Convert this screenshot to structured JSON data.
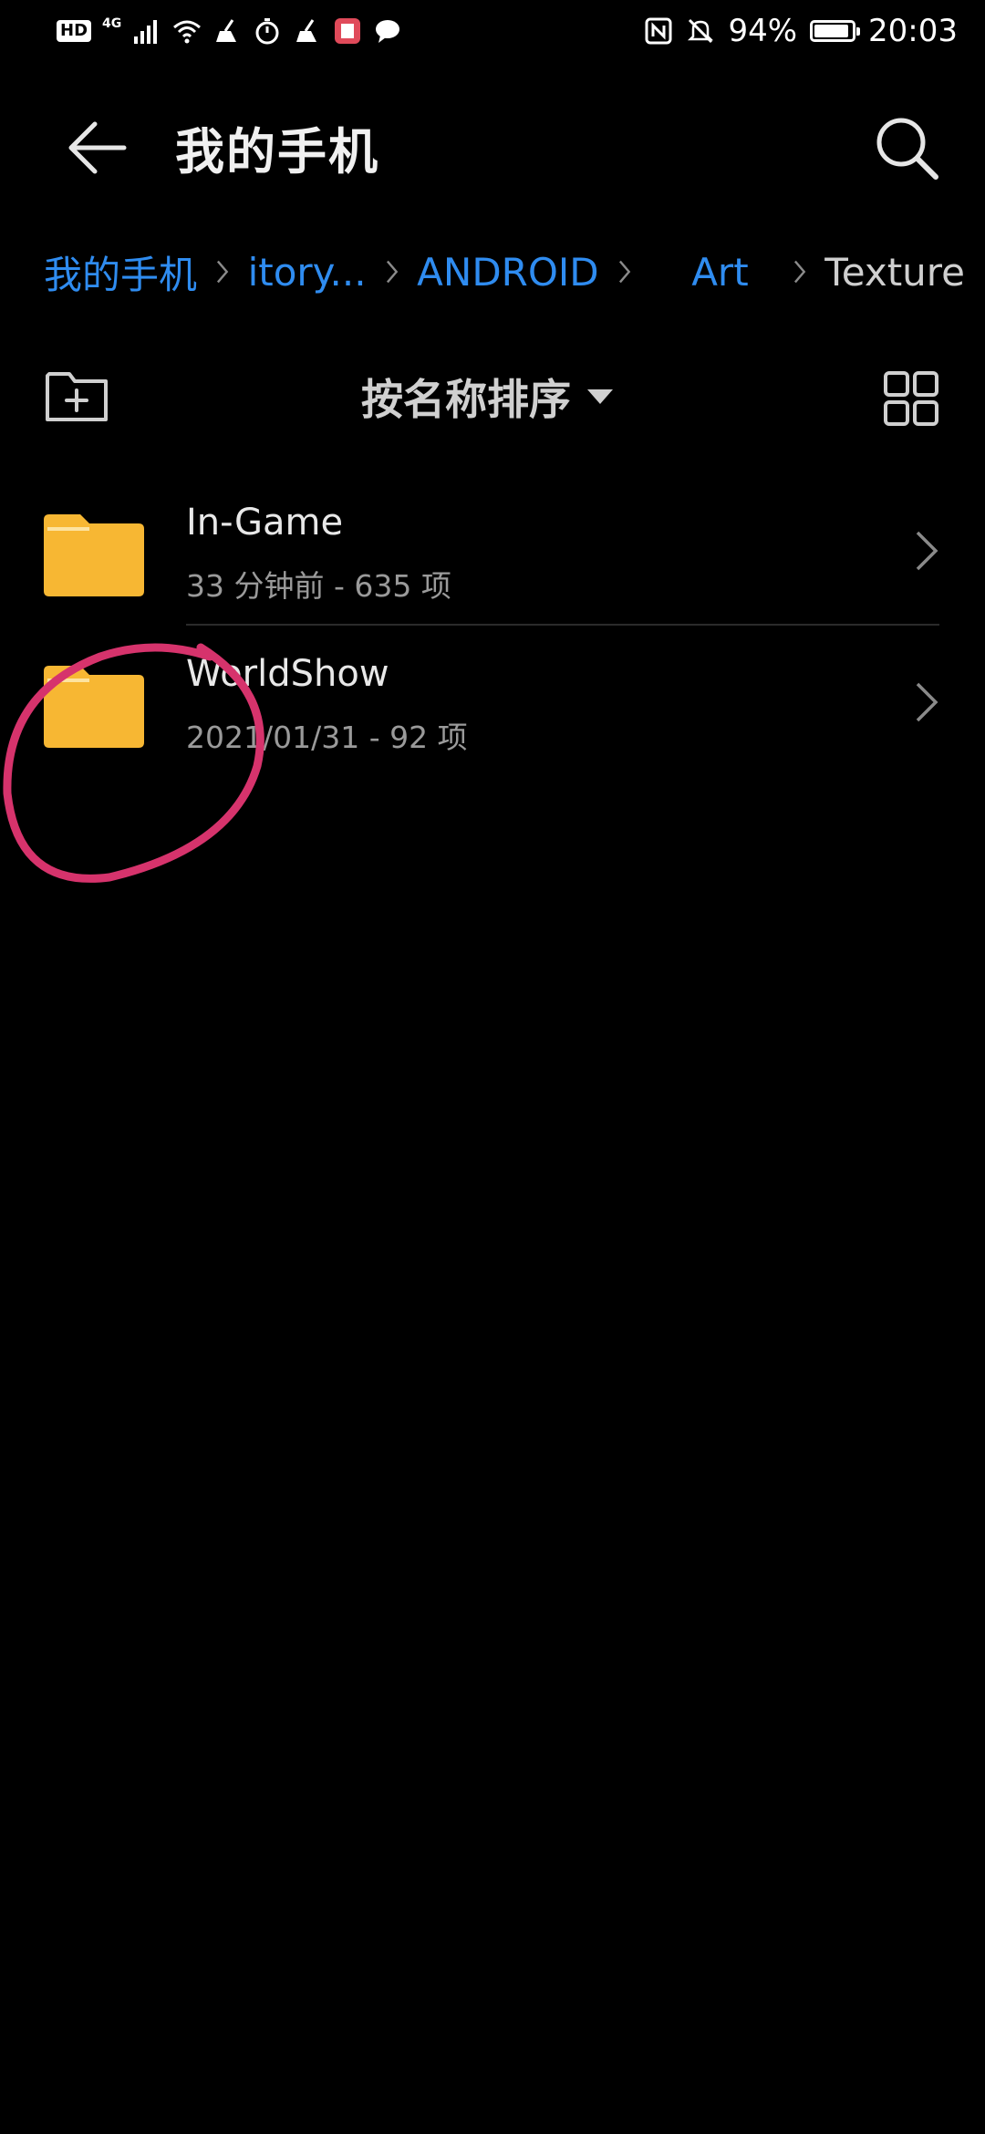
{
  "status_bar": {
    "hd_badge": "HD",
    "network": "4G",
    "battery_percent": "94%",
    "battery_level": 0.94,
    "time": "20:03"
  },
  "header": {
    "title": "我的手机",
    "icons": {
      "back": "arrow-left-icon",
      "search": "search-icon"
    }
  },
  "breadcrumb": [
    {
      "label": "我的手机"
    },
    {
      "label": "itory..."
    },
    {
      "label": "ANDROID"
    },
    {
      "label": "Art"
    },
    {
      "label": "Texture"
    }
  ],
  "toolbar": {
    "sort_label": "按名称排序",
    "icons": {
      "new_folder": "new-folder-icon",
      "grid_view": "grid-view-icon",
      "sort_caret": "caret-down-icon"
    }
  },
  "files": [
    {
      "name": "In-Game",
      "meta": "33 分钟前 - 635 项"
    },
    {
      "name": "WorldShow",
      "meta": "2021/01/31 - 92 项"
    }
  ],
  "colors": {
    "background": "#000000",
    "accent": "#2f8cf0",
    "folder": "#f7b733",
    "annotation": "#d6336c"
  }
}
